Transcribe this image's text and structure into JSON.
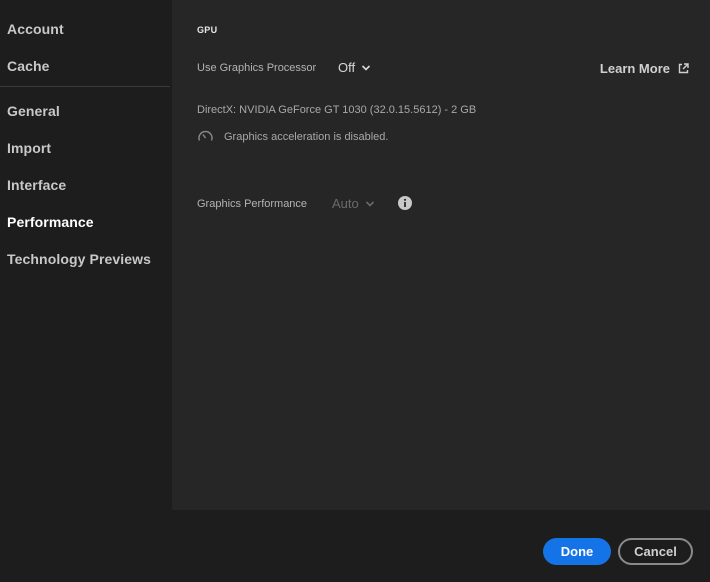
{
  "sidebar": {
    "items": [
      {
        "label": "Account"
      },
      {
        "label": "Cache"
      },
      {
        "label": "General"
      },
      {
        "label": "Import"
      },
      {
        "label": "Interface"
      },
      {
        "label": "Performance"
      },
      {
        "label": "Technology Previews"
      }
    ]
  },
  "gpu": {
    "section_title": "GPU",
    "use_gpu_label": "Use Graphics Processor",
    "use_gpu_value": "Off",
    "learn_more": "Learn More",
    "directx_info": "DirectX: NVIDIA GeForce GT 1030 (32.0.15.5612) - 2 GB",
    "status_text": "Graphics acceleration is disabled.",
    "performance_label": "Graphics Performance",
    "performance_value": "Auto"
  },
  "footer": {
    "done_label": "Done",
    "cancel_label": "Cancel"
  },
  "colors": {
    "accent": "#1473e6",
    "background": "#1d1d1d",
    "panel": "#262626"
  }
}
